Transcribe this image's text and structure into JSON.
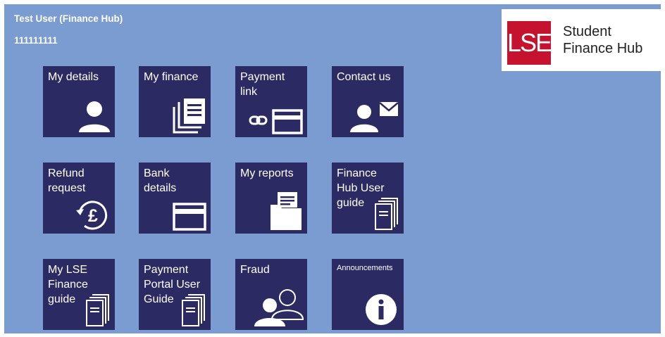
{
  "user": {
    "name": "Test User (Finance Hub)",
    "id": "111111111"
  },
  "logo": {
    "mark": "LSE",
    "line1": "Student",
    "line2": "Finance Hub",
    "mark_color": "#c4122f"
  },
  "colors": {
    "background": "#7b9cd0",
    "tile": "#2b2a63",
    "text": "#ffffff"
  },
  "tiles": [
    {
      "label": "My details",
      "icon": "person-icon"
    },
    {
      "label": "My finance",
      "icon": "document-icon"
    },
    {
      "label": "Payment\nlink",
      "icon": "link-card-icon"
    },
    {
      "label": "Contact us",
      "icon": "person-mail-icon"
    },
    {
      "label": "Refund\nrequest",
      "icon": "refund-pound-icon"
    },
    {
      "label": "Bank\ndetails",
      "icon": "bank-card-icon"
    },
    {
      "label": "My reports",
      "icon": "folder-report-icon"
    },
    {
      "label": "Finance\nHub User\nguide",
      "icon": "guide-documents-icon"
    },
    {
      "label": "My LSE\nFinance\nguide",
      "icon": "guide-documents-icon"
    },
    {
      "label": "Payment\nPortal User\nGuide",
      "icon": "guide-documents-icon"
    },
    {
      "label": "Fraud",
      "icon": "people-icon"
    },
    {
      "label": "Announcements",
      "icon": "info-icon"
    }
  ]
}
